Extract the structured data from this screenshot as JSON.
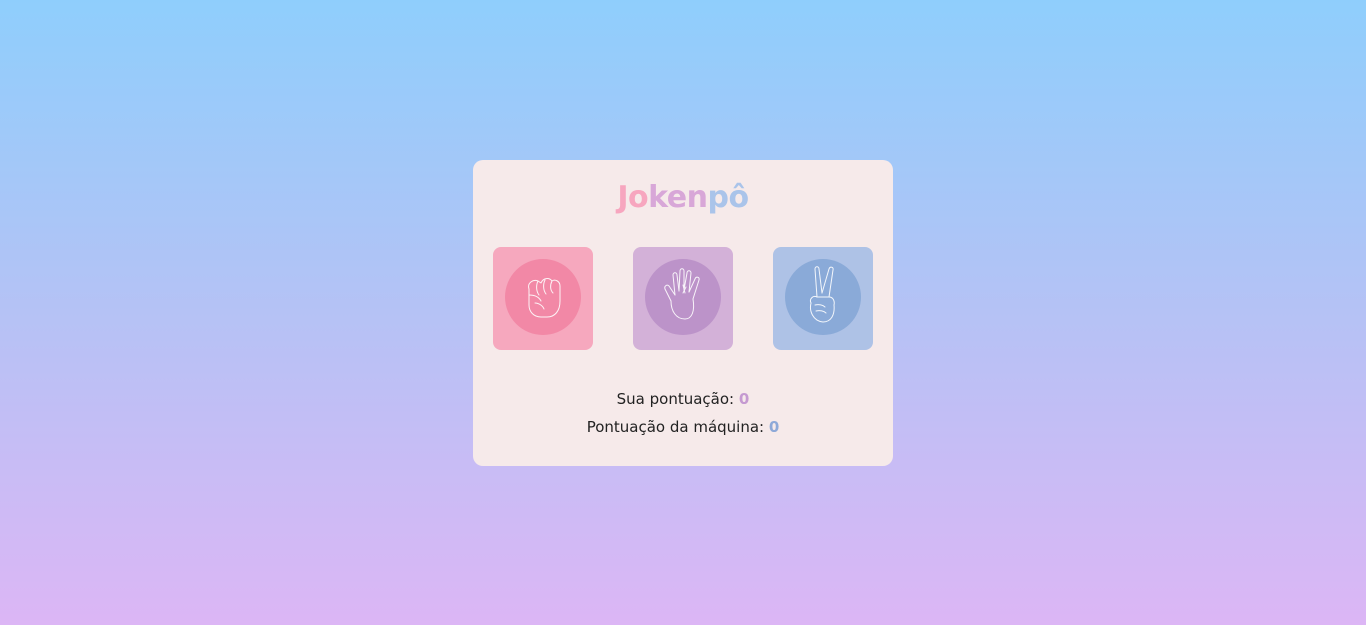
{
  "title": {
    "part1": "Jo",
    "part2": "ken",
    "part3": "pô"
  },
  "choices": [
    {
      "name": "rock",
      "icon": "fist-hand-icon",
      "color": "#f6a8be",
      "circle_color": "#f288a6"
    },
    {
      "name": "paper",
      "icon": "open-hand-icon",
      "color": "#d3b1d8",
      "circle_color": "#bc93c9"
    },
    {
      "name": "scissors",
      "icon": "peace-hand-icon",
      "color": "#aec2e6",
      "circle_color": "#8aaad8"
    }
  ],
  "scores": {
    "user_label": "Sua pontuação:",
    "user_value": "0",
    "machine_label": "Pontuação da máquina:",
    "machine_value": "0"
  },
  "colors": {
    "background_top": "#8fcefc",
    "background_bottom": "#dcb6f5",
    "card": "#f6eaea",
    "user_score": "#c59ad1",
    "machine_score": "#8ea9d8"
  }
}
